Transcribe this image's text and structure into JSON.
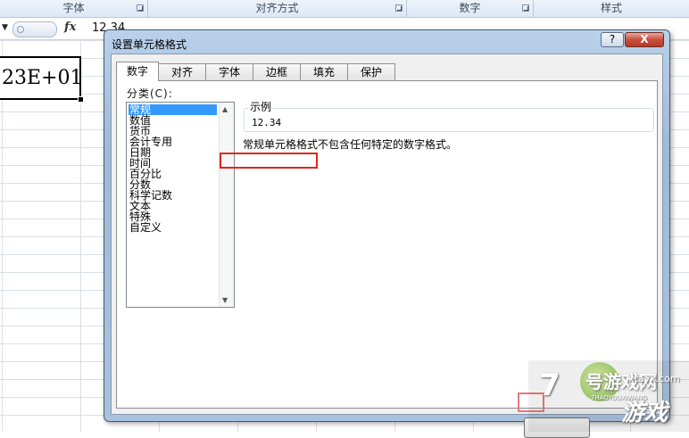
{
  "ribbon_groups": [
    {
      "label": "字体"
    },
    {
      "label": "对齐方式"
    },
    {
      "label": "数字"
    },
    {
      "label": "样式"
    }
  ],
  "formula_bar": {
    "fx_label": "fx",
    "value": "12.34"
  },
  "active_cell": {
    "value": "23E+01"
  },
  "dialog": {
    "title": "设置单元格格式",
    "help_label": "?",
    "close_label": "X",
    "tabs": [
      {
        "label": "数字",
        "active": true
      },
      {
        "label": "对齐",
        "active": false
      },
      {
        "label": "字体",
        "active": false
      },
      {
        "label": "边框",
        "active": false
      },
      {
        "label": "填充",
        "active": false
      },
      {
        "label": "保护",
        "active": false
      }
    ],
    "category_label": "分类(C):",
    "categories": [
      {
        "label": "常规",
        "selected": true
      },
      {
        "label": "数值",
        "selected": false
      },
      {
        "label": "货币",
        "selected": false
      },
      {
        "label": "会计专用",
        "selected": false
      },
      {
        "label": "日期",
        "selected": false
      },
      {
        "label": "时间",
        "selected": false
      },
      {
        "label": "百分比",
        "selected": false
      },
      {
        "label": "分数",
        "selected": false
      },
      {
        "label": "科学记数",
        "selected": false
      },
      {
        "label": "文本",
        "selected": false
      },
      {
        "label": "特殊",
        "selected": false
      },
      {
        "label": "自定义",
        "selected": false
      }
    ],
    "sample_label": "示例",
    "sample_value": "12.34",
    "description": "常规单元格格式不包含任何特定的数字格式。"
  },
  "watermark": {
    "number": "7",
    "brand": "号游戏网",
    "site": "xtayx.com",
    "pinyin": "7HAOYOUXIWANG",
    "game": "游戏"
  },
  "colors": {
    "selection": "#3399ff",
    "highlight_box": "#e0261b",
    "dialog_frame": "#a8c2de",
    "close_button": "#c7503c"
  }
}
